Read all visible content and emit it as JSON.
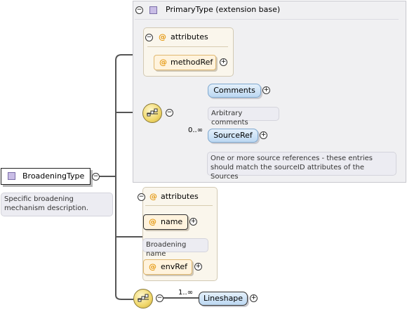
{
  "diagram": {
    "root": {
      "name": "BroadeningType",
      "doc_line1": "Specific broadening",
      "doc_line2": "mechanism description."
    },
    "extension": {
      "title": "PrimaryType (extension base)",
      "attributes_label": "attributes",
      "attribute": "methodRef",
      "sequence": {
        "comments": "Comments",
        "comments_doc": "Arbitrary comments",
        "cardinality": "0..∞",
        "sourceref": "SourceRef",
        "sourceref_doc_line1": "One or more source references - these entries",
        "sourceref_doc_line2": "should match the sourceID attributes of the Sources"
      }
    },
    "own_attributes": {
      "label": "attributes",
      "name_attr": "name",
      "name_doc": "Broadening name",
      "envref_attr": "envRef"
    },
    "lineshape": {
      "cardinality": "1..∞",
      "label": "Lineshape"
    },
    "symbols": {
      "at": "@",
      "minus": "−",
      "plus": "+"
    }
  }
}
